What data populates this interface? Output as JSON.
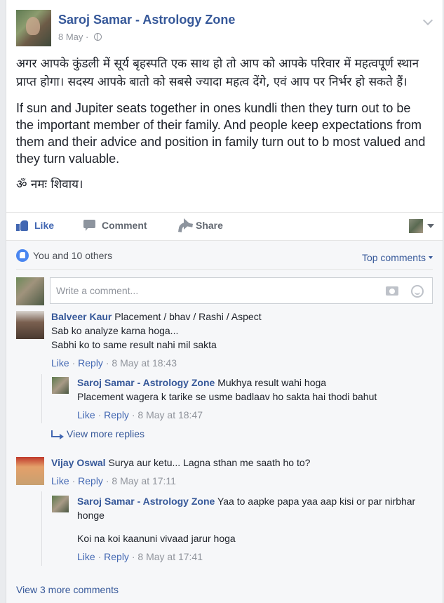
{
  "post": {
    "author": "Saroj Samar - Astrology Zone",
    "date": "8 May",
    "separator": "·",
    "text_hindi": "अगर आपके कुंडली में सूर्य बृहस्पति एक साथ हो तो आप को आपके परिवार में महत्वपूर्ण स्थान प्राप्त होगा। सदस्य आपके बातो को सबसे ज्यादा महत्व देंगे, एवं आप पर निर्भर हो सकते हैं।",
    "text_english": "If sun and Jupiter seats together in ones kundli then they turn out to be the important member of their family. And people keep expectations from them and their advice and position in family turn out to b most valued and they turn valuable.",
    "text_closing": "ॐ नमः शिवाय।"
  },
  "actions": {
    "like": "Like",
    "comment": "Comment",
    "share": "Share"
  },
  "reactions": {
    "summary": "You and 10 others",
    "sort": "Top comments"
  },
  "composer": {
    "placeholder": "Write a comment..."
  },
  "comments": [
    {
      "name": "Balveer Kaur",
      "text_inline": "Placement / bhav / Rashi / Aspect",
      "lines": [
        "Sab ko analyze karna hoga...",
        "Sabhi ko to same result nahi mil sakta"
      ],
      "like": "Like",
      "reply": "Reply",
      "time": "8 May at 18:43",
      "replies": [
        {
          "name": "Saroj Samar - Astrology Zone",
          "text_inline": "Mukhya result wahi hoga",
          "lines": [
            "Placement wagera k tarike se usme badlaav ho sakta hai thodi bahut"
          ],
          "like": "Like",
          "reply": "Reply",
          "time": "8 May at 18:47"
        }
      ],
      "view_more": "View more replies"
    },
    {
      "name": "Vijay Oswal",
      "text_inline": "Surya aur ketu... Lagna sthan me saath ho to?",
      "like": "Like",
      "reply": "Reply",
      "time": "8 May at 17:11",
      "replies": [
        {
          "name": "Saroj Samar - Astrology Zone",
          "text_inline": "Yaa to aapke papa yaa aap kisi or par nirbhar honge",
          "lines": [
            "Koi na koi kaanuni vivaad jarur hoga"
          ],
          "like": "Like",
          "reply": "Reply",
          "time": "8 May at 17:41"
        }
      ]
    }
  ],
  "view_more_comments": "View 3 more comments",
  "sep": " · "
}
